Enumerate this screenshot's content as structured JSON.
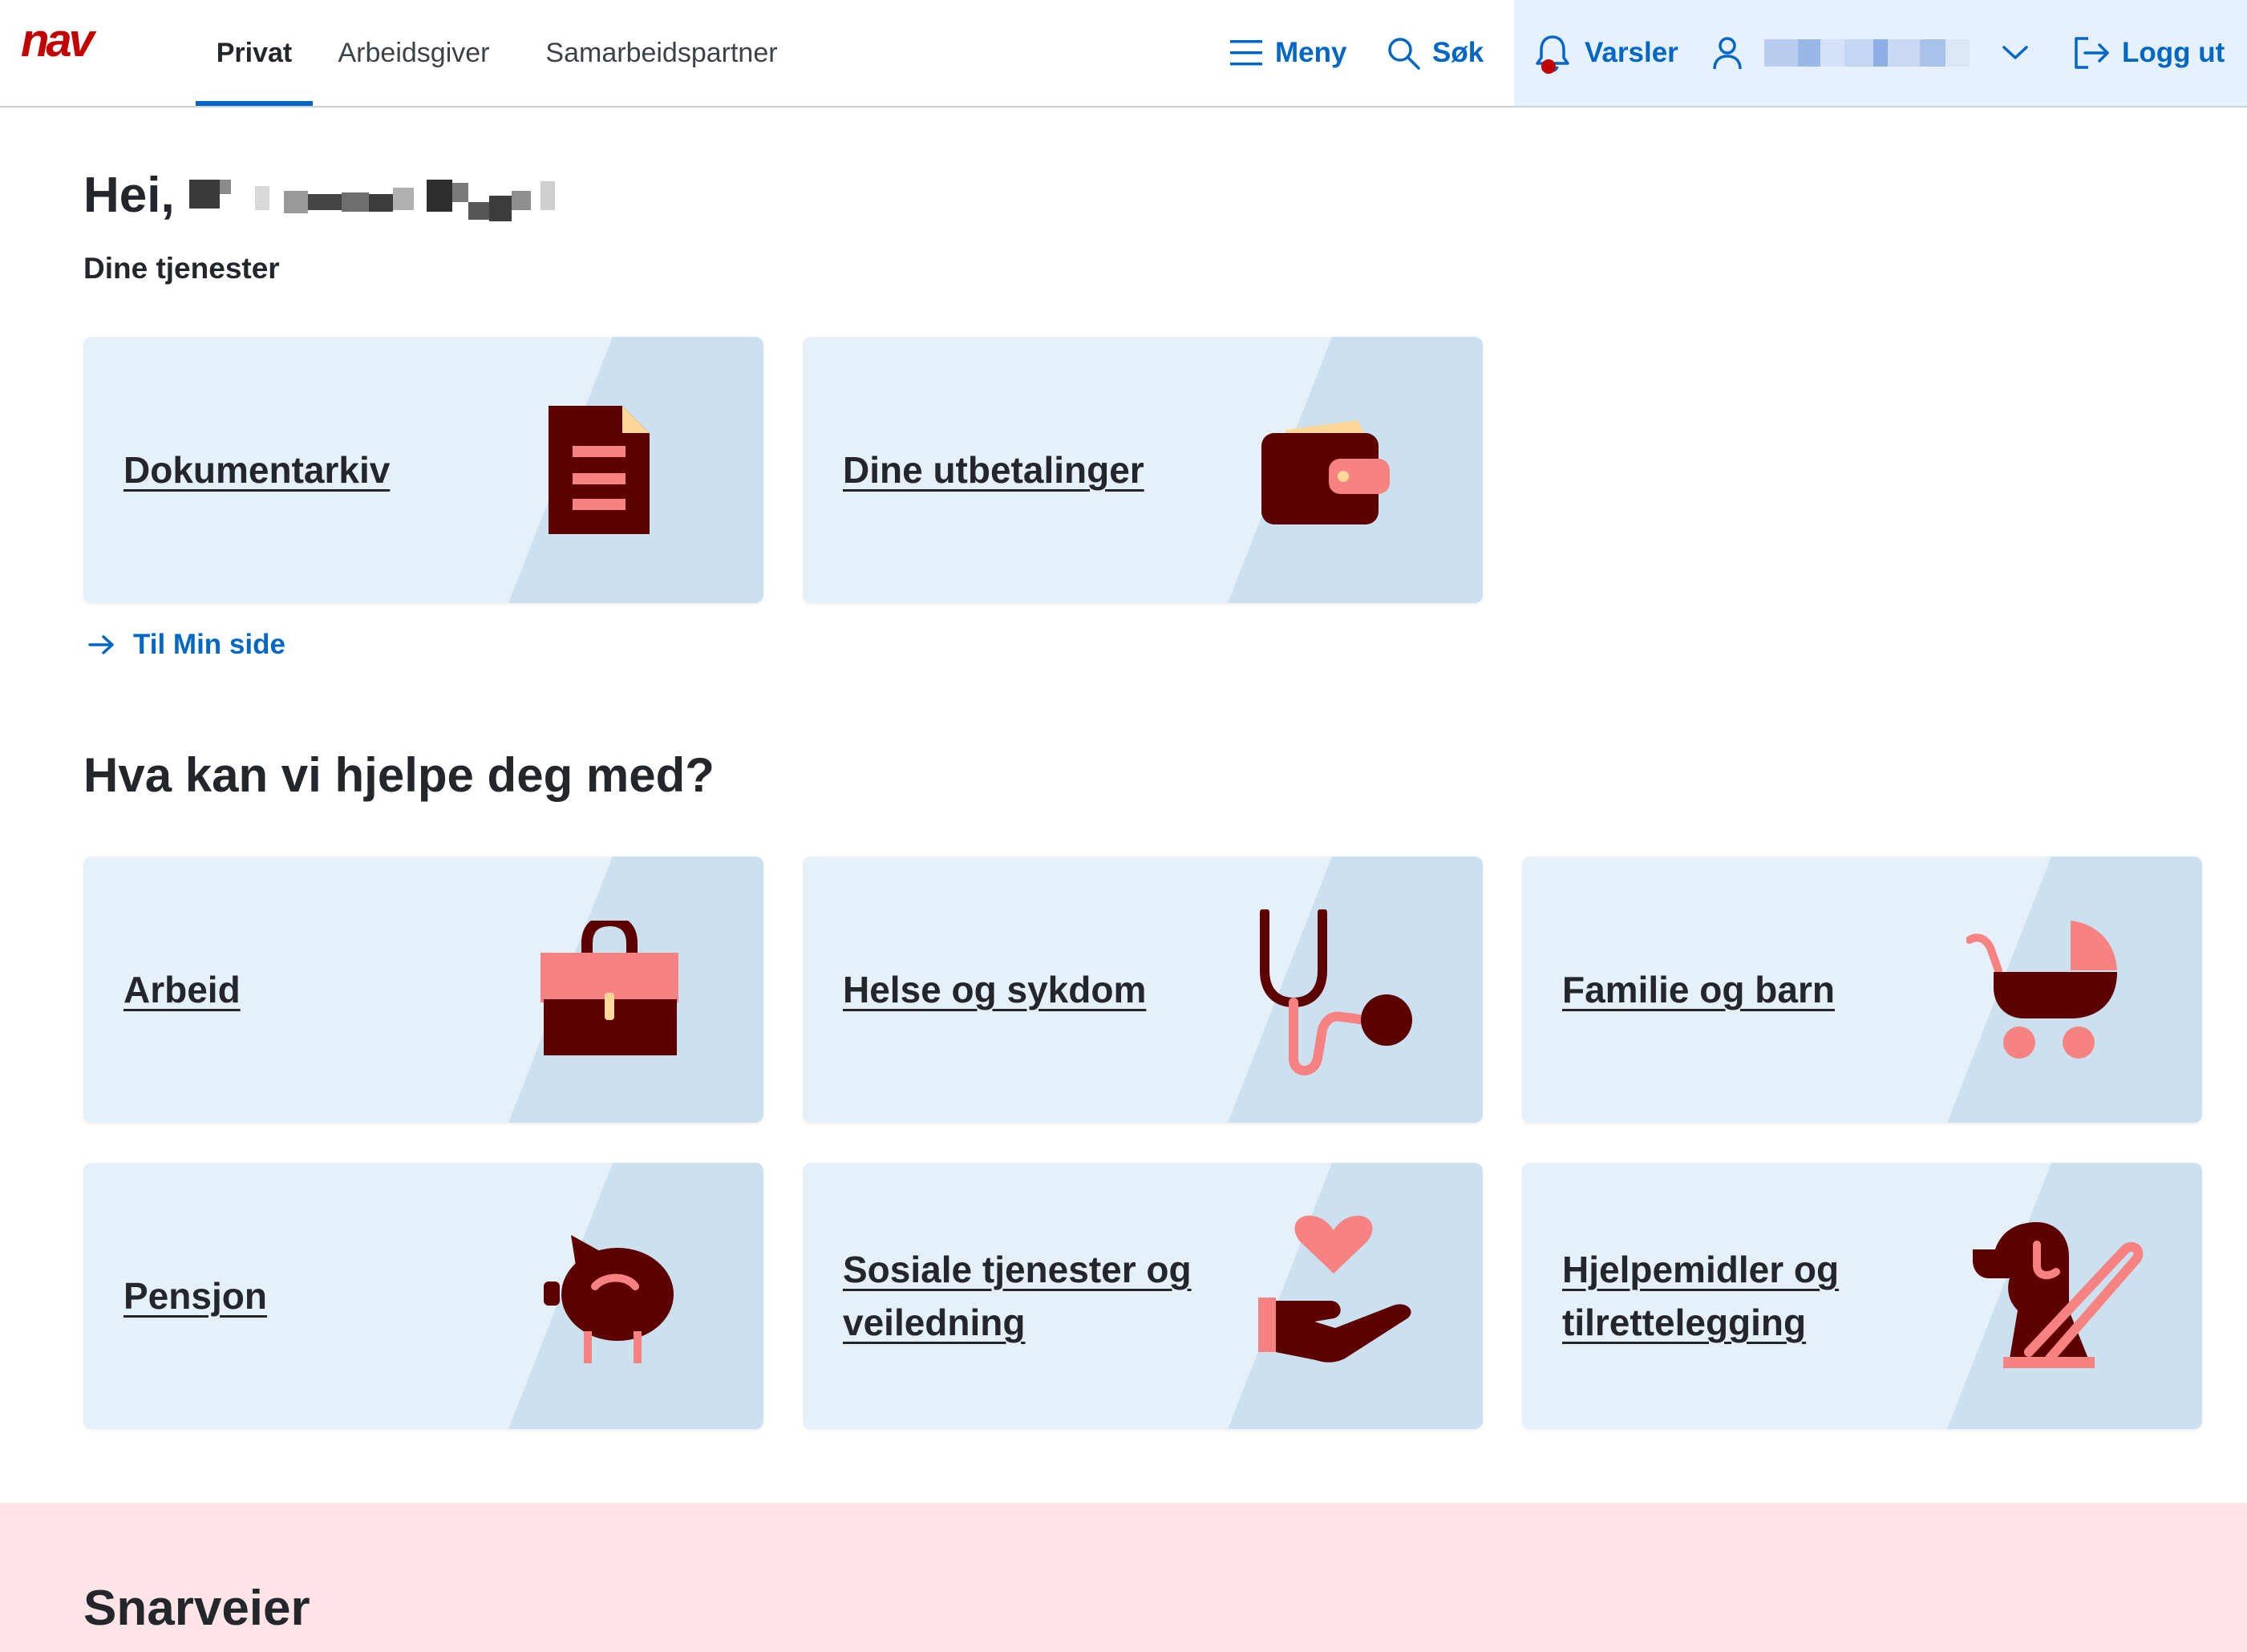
{
  "header": {
    "logo_text": "nav",
    "tabs": [
      {
        "label": "Privat",
        "active": true
      },
      {
        "label": "Arbeidsgiver",
        "active": false
      },
      {
        "label": "Samarbeidspartner",
        "active": false
      }
    ],
    "menu_label": "Meny",
    "search_label": "Søk",
    "notifications_label": "Varsler",
    "logout_label": "Logg ut",
    "notification_dot_color": "#c30000",
    "accent_color": "#0067c5",
    "user_area_bg": "#e6f0ff"
  },
  "main": {
    "greeting": "Hei,",
    "services_heading": "Dine tjenester",
    "service_cards": [
      {
        "label": "Dokumentarkiv",
        "icon": "document-icon"
      },
      {
        "label": "Dine utbetalinger",
        "icon": "wallet-icon"
      }
    ],
    "min_side_link": "Til Min side",
    "help_heading": "Hva kan vi hjelpe deg med?",
    "help_cards": [
      {
        "label": "Arbeid",
        "icon": "briefcase-icon"
      },
      {
        "label": "Helse og sykdom",
        "icon": "stethoscope-icon"
      },
      {
        "label": "Familie og barn",
        "icon": "stroller-icon"
      },
      {
        "label": "Pensjon",
        "icon": "piggy-bank-icon"
      },
      {
        "label": "Sosiale tjenester og veiledning",
        "icon": "heart-hand-icon"
      },
      {
        "label": "Hjelpemidler og tilrettelegging",
        "icon": "guide-dog-icon"
      }
    ]
  },
  "shortcuts": {
    "heading": "Snarveier",
    "bg_color": "#ffe4e8"
  }
}
